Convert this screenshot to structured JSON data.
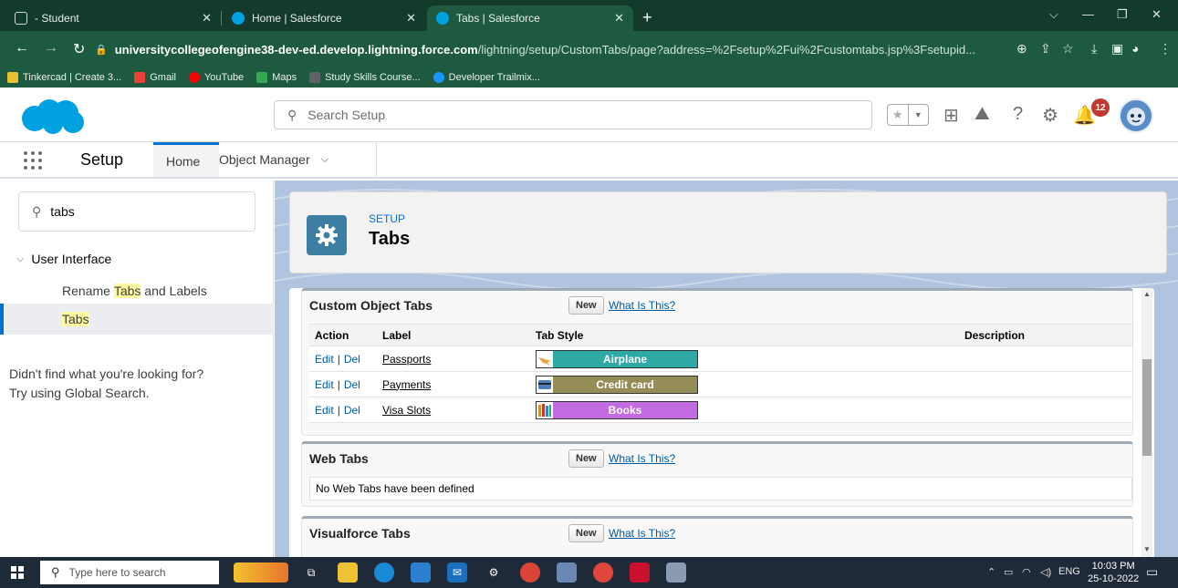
{
  "browser": {
    "tabs": [
      {
        "title": "- Student",
        "active": false
      },
      {
        "title": "Home | Salesforce",
        "active": false
      },
      {
        "title": "Tabs | Salesforce",
        "active": true
      }
    ],
    "new_tab_label": "+",
    "url_host": "universitycollegeofengine38-dev-ed.develop.lightning.force.com",
    "url_path": "/lightning/setup/CustomTabs/page?address=%2Fsetup%2Fui%2Fcustomtabs.jsp%3Fsetupid...",
    "bookmarks": [
      {
        "label": "Tinkercad | Create 3...",
        "icon": "tinkercad-icon",
        "color": "#e8c130"
      },
      {
        "label": "Gmail",
        "icon": "gmail-icon",
        "color": "#ea4335"
      },
      {
        "label": "YouTube",
        "icon": "youtube-icon",
        "color": "#ff0000"
      },
      {
        "label": "Maps",
        "icon": "maps-icon",
        "color": "#34a853"
      },
      {
        "label": "Study Skills Course...",
        "icon": "study-icon",
        "color": "#5f6368"
      },
      {
        "label": "Developer Trailmix...",
        "icon": "trailhead-icon",
        "color": "#1b96ff"
      }
    ]
  },
  "header": {
    "search_placeholder": "Search Setup",
    "notification_count": "12"
  },
  "context_bar": {
    "app_name": "Setup",
    "tabs": [
      {
        "label": "Home",
        "active": true
      },
      {
        "label": "Object Manager",
        "active": false
      }
    ]
  },
  "sidebar": {
    "quick_find_value": "tabs",
    "section": "User Interface",
    "items": [
      {
        "pre": "Rename ",
        "hl": "Tabs",
        "post": " and Labels",
        "selected": false
      },
      {
        "pre": "",
        "hl": "Tabs",
        "post": "",
        "selected": true
      }
    ],
    "not_found_line1": "Didn't find what you're looking for?",
    "not_found_line2": "Try using Global Search."
  },
  "page": {
    "kicker": "SETUP",
    "title": "Tabs"
  },
  "custom_object_tabs": {
    "title": "Custom Object Tabs",
    "new_label": "New",
    "help_label": "What Is This?",
    "columns": [
      "Action",
      "Label",
      "Tab Style",
      "Description"
    ],
    "edit_label": "Edit",
    "del_label": "Del",
    "rows": [
      {
        "label": "Passports",
        "style": "Airplane",
        "color": "#2ea9a5",
        "icon": "airplane-icon",
        "icon_color": "#e8a33c"
      },
      {
        "label": "Payments",
        "style": "Credit card",
        "color": "#948d58",
        "icon": "credit-card-icon",
        "icon_color": "#4a7fb8"
      },
      {
        "label": "Visa Slots",
        "style": "Books",
        "color": "#c36be0",
        "icon": "books-icon",
        "icon_color": "#d8902d"
      }
    ]
  },
  "web_tabs": {
    "title": "Web Tabs",
    "new_label": "New",
    "help_label": "What Is This?",
    "empty_text": "No Web Tabs have been defined"
  },
  "visualforce_tabs": {
    "title": "Visualforce Tabs",
    "new_label": "New",
    "help_label": "What Is This?"
  },
  "taskbar": {
    "search_placeholder": "Type here to search",
    "language": "ENG",
    "time": "10:03 PM",
    "date": "25-10-2022"
  },
  "colors": {
    "brand": "#00a1e0",
    "accent": "#0070d2",
    "chrome": "#1e5a40"
  }
}
